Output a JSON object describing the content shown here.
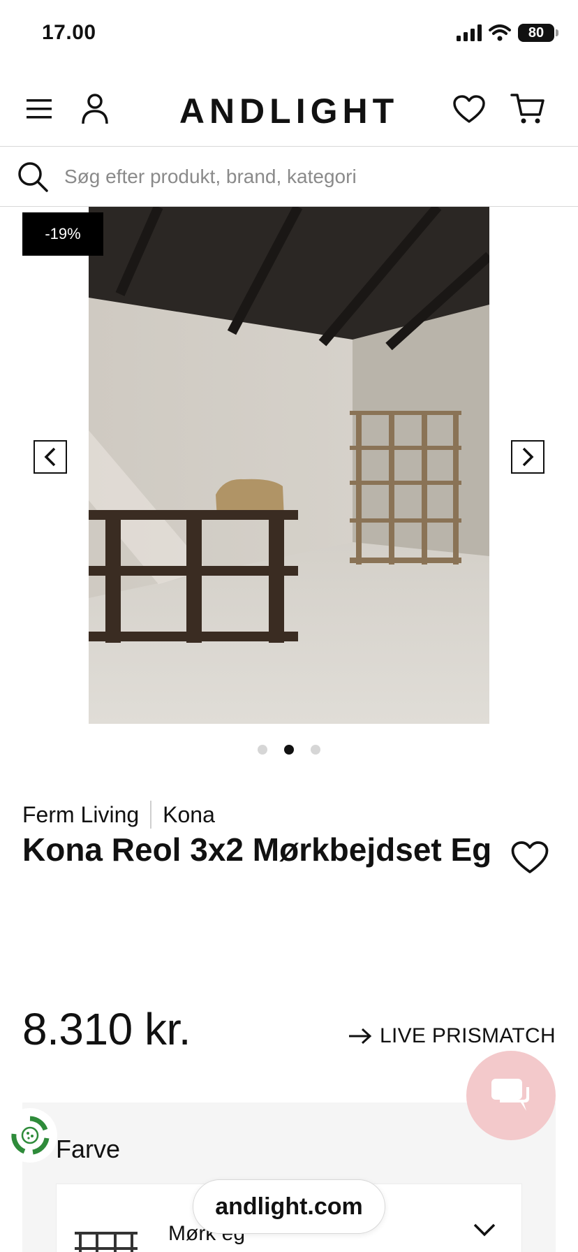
{
  "status_bar": {
    "time": "17.00",
    "battery": "80"
  },
  "header": {
    "logo": "ANDLIGHT"
  },
  "search": {
    "placeholder": "Søg efter produkt, brand, kategori"
  },
  "gallery": {
    "discount": "-19%",
    "total_images": 3,
    "active_index": 1
  },
  "product": {
    "brand": "Ferm Living",
    "series": "Kona",
    "title": "Kona Reol 3x2 Mørkbejdset Eg",
    "price": "8.310 kr.",
    "prismatch_label": "LIVE PRISMATCH"
  },
  "variant": {
    "label": "Farve",
    "value": "Mørk eg"
  },
  "browser": {
    "url": "andlight.com"
  },
  "colors": {
    "accent_chat": "#f3c9cb",
    "badge_bg": "#000000",
    "eco_green": "#2e8b3a"
  }
}
